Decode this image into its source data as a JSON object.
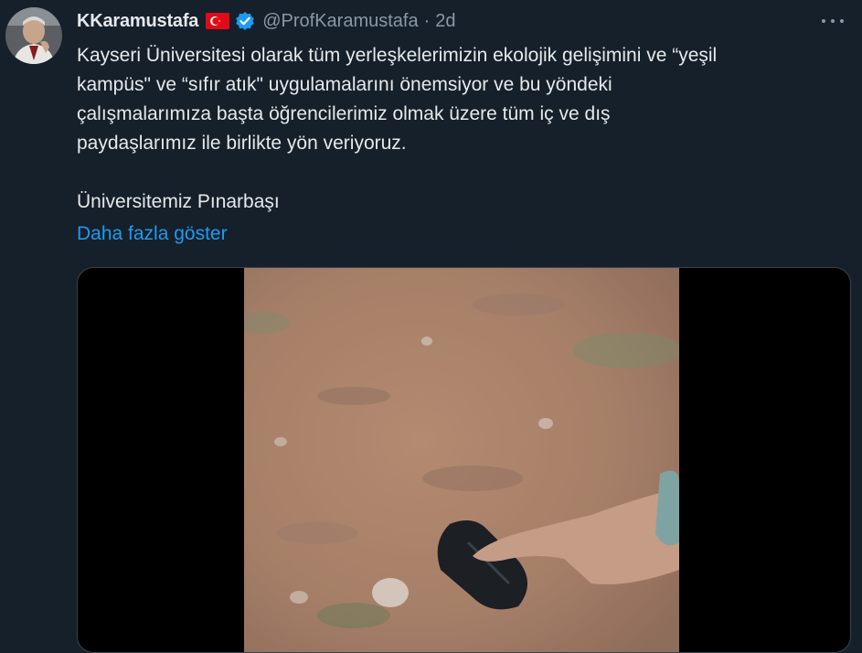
{
  "author": {
    "display_name": "KKaramustafa",
    "handle": "@ProfKaramustafa",
    "separator": "·",
    "time": "2d",
    "flag_icon": "turkey-flag-icon",
    "verified_icon": "verified-badge-icon",
    "verified_color": "#1d9bf0"
  },
  "tweet": {
    "lines": [
      "Kayseri Üniversitesi olarak tüm yerleşkelerimizin ekolojik gelişimini ve “yeşil",
      "kampüs\" ve “sıfır atık\" uygulamalarını önemsiyor ve bu yöndeki",
      "çalışmalarımıza başta öğrencilerimiz olmak üzere tüm iç ve dış",
      "paydaşlarımız ile birlikte yön veriyoruz."
    ],
    "second_paragraph": "Üniversitemiz Pınarbaşı",
    "show_more": "Daha fazla göster"
  },
  "colors": {
    "background": "#15202b",
    "text": "#e7e9ea",
    "secondary": "#8b98a5",
    "link": "#1d9bf0"
  }
}
